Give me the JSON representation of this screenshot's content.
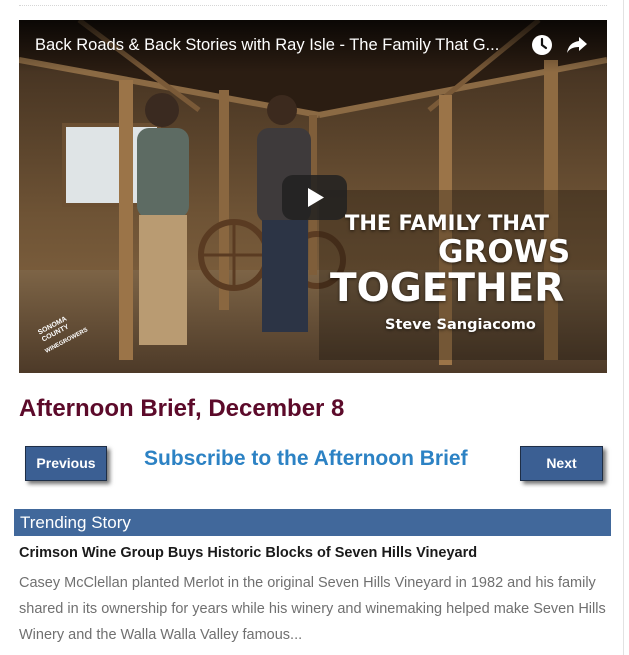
{
  "video": {
    "title": "Back Roads & Back Stories with Ray Isle - The Family That G...",
    "overlay": {
      "line1": "THE FAMILY THAT",
      "line2": "GROWS",
      "line3": "TOGETHER",
      "person": "Steve Sangiacomo"
    },
    "logo": {
      "brand": "SONOMA\nCOUNTY",
      "sub": "WINEGROWERS"
    }
  },
  "article": {
    "headline": "Afternoon Brief, December 8"
  },
  "nav": {
    "previous_label": "Previous",
    "next_label": "Next",
    "subscribe_label": "Subscribe to the Afternoon Brief"
  },
  "trending": {
    "heading": "Trending Story",
    "title": "Crimson Wine Group Buys Historic Blocks of Seven Hills Vineyard",
    "excerpt": "Casey McClellan planted Merlot in the original Seven Hills Vineyard in 1982 and his family shared in its ownership for years while his winery and winemaking helped make Seven Hills Winery and the Walla Walla Valley famous..."
  },
  "colors": {
    "headline": "#5c0a2a",
    "button_bg": "#3b5f93",
    "subscribe_link": "#2c82c4",
    "trending_bar": "#41689b"
  },
  "icons": [
    "watch-later-icon",
    "share-icon",
    "play-icon"
  ]
}
